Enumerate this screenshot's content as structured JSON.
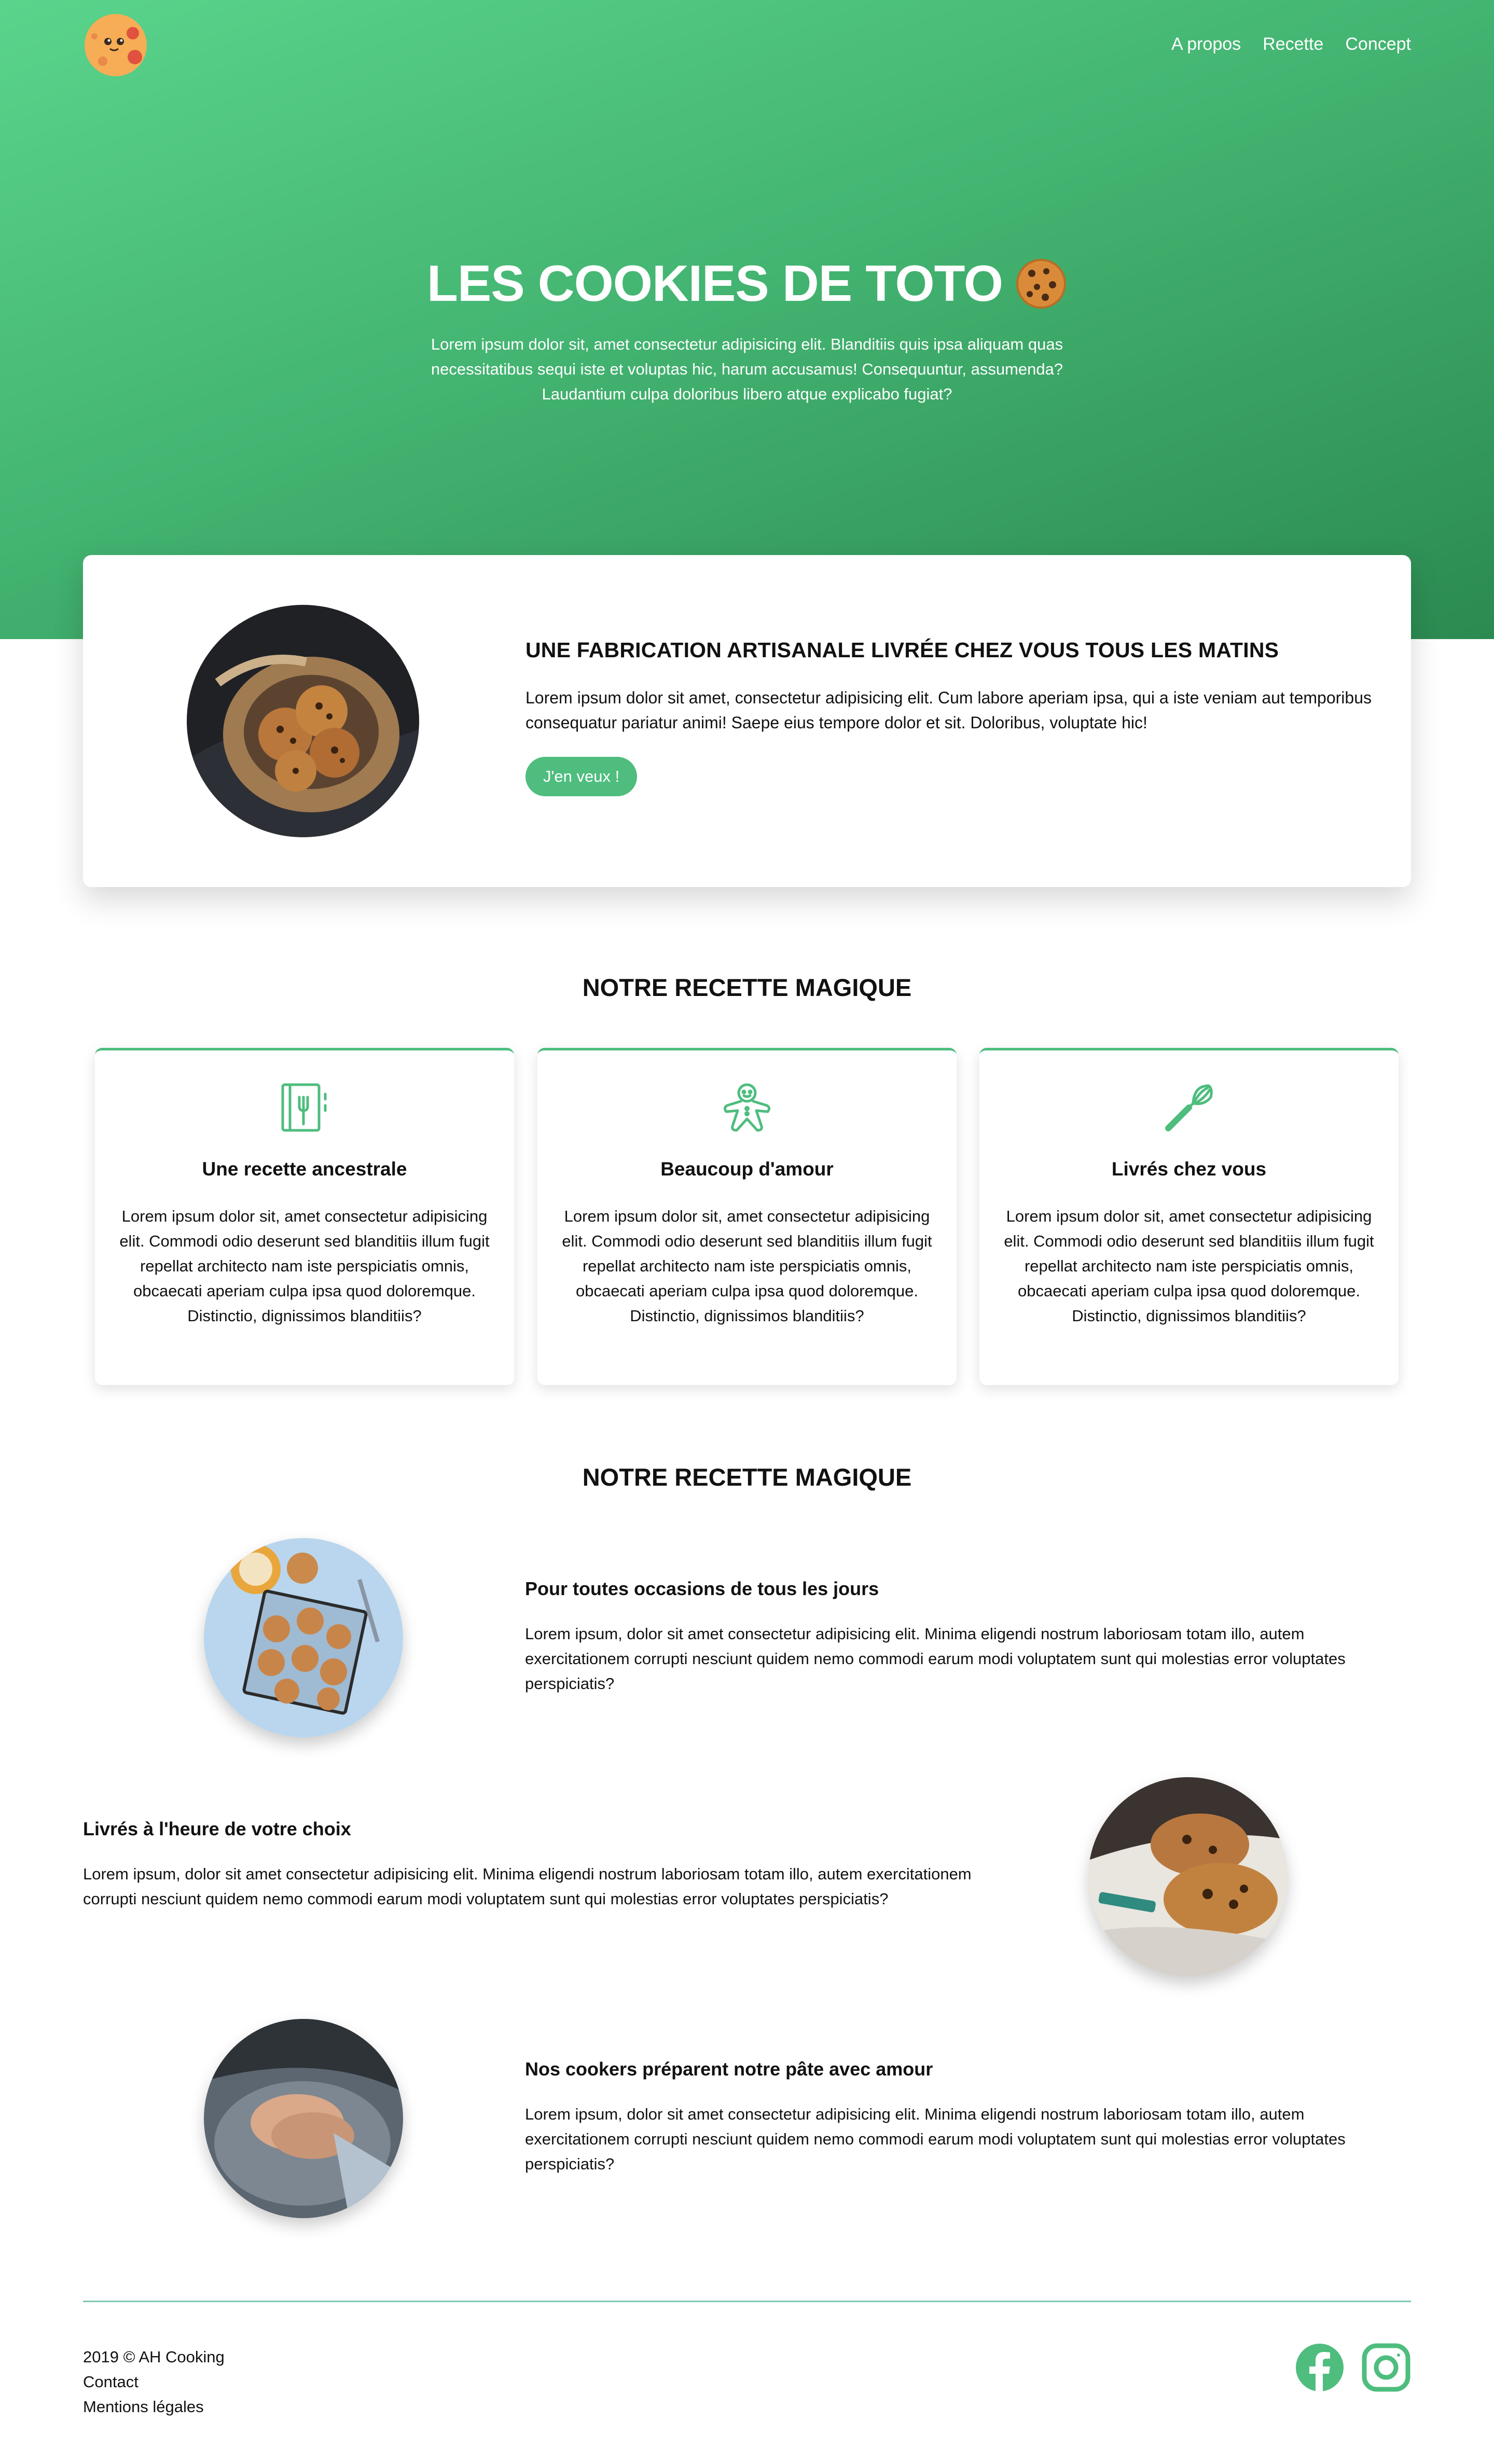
{
  "brand": {
    "accent": "#4ebd7e",
    "hero_gradient": [
      "#5ad48c",
      "#2b8a50"
    ]
  },
  "nav": {
    "items": [
      "A propos",
      "Recette",
      "Concept"
    ]
  },
  "hero": {
    "title": "LES COOKIES DE TOTO",
    "emoji_icon": "cookie-icon",
    "subtitle": "Lorem ipsum dolor sit, amet consectetur adipisicing elit. Blanditiis quis ipsa aliquam quas necessitatibus sequi iste et voluptas hic, harum accusamus! Consequuntur, assumenda? Laudantium culpa doloribus libero atque explicabo fugiat?"
  },
  "feature": {
    "title": "UNE FABRICATION ARTISANALE LIVRÉE CHEZ VOUS TOUS LES MATINS",
    "text": "Lorem ipsum dolor sit amet, consectetur adipisicing elit. Cum labore aperiam ipsa, qui a iste veniam aut temporibus consequatur pariatur animi! Saepe eius tempore dolor et sit. Doloribus, voluptate hic!",
    "button": "J'en veux !"
  },
  "recipe": {
    "title": "NOTRE RECETTE MAGIQUE",
    "cards": [
      {
        "icon": "recipe-book-icon",
        "title": "Une recette ancestrale",
        "text": "Lorem ipsum dolor sit, amet consectetur adipisicing elit. Commodi odio deserunt sed blanditiis illum fugit repellat architecto nam iste perspiciatis omnis, obcaecati aperiam culpa ipsa quod doloremque. Distinctio, dignissimos blanditiis?"
      },
      {
        "icon": "gingerbread-icon",
        "title": "Beaucoup d'amour",
        "text": "Lorem ipsum dolor sit, amet consectetur adipisicing elit. Commodi odio deserunt sed blanditiis illum fugit repellat architecto nam iste perspiciatis omnis, obcaecati aperiam culpa ipsa quod doloremque. Distinctio, dignissimos blanditiis?"
      },
      {
        "icon": "whisk-icon",
        "title": "Livrés chez vous",
        "text": "Lorem ipsum dolor sit, amet consectetur adipisicing elit. Commodi odio deserunt sed blanditiis illum fugit repellat architecto nam iste perspiciatis omnis, obcaecati aperiam culpa ipsa quod doloremque. Distinctio, dignissimos blanditiis?"
      }
    ]
  },
  "rows": {
    "title": "NOTRE RECETTE MAGIQUE",
    "items": [
      {
        "title": "Pour toutes occasions de tous les jours",
        "text": "Lorem ipsum, dolor sit amet consectetur adipisicing elit. Minima eligendi nostrum laboriosam totam illo, autem exercitationem corrupti nesciunt quidem nemo commodi earum modi voluptatem sunt qui molestias error voluptates perspiciatis?"
      },
      {
        "title": "Livrés à l'heure de votre choix",
        "text": "Lorem ipsum, dolor sit amet consectetur adipisicing elit. Minima eligendi nostrum laboriosam totam illo, autem exercitationem corrupti nesciunt quidem nemo commodi earum modi voluptatem sunt qui molestias error voluptates perspiciatis?"
      },
      {
        "title": "Nos cookers préparent notre pâte avec amour",
        "text": "Lorem ipsum, dolor sit amet consectetur adipisicing elit. Minima eligendi nostrum laboriosam totam illo, autem exercitationem corrupti nesciunt quidem nemo commodi earum modi voluptatem sunt qui molestias error voluptates perspiciatis?"
      }
    ]
  },
  "footer": {
    "copyright": "2019 © AH Cooking",
    "contact": "Contact",
    "legal": "Mentions légales",
    "social_icons": [
      "facebook-icon",
      "instagram-icon"
    ]
  }
}
